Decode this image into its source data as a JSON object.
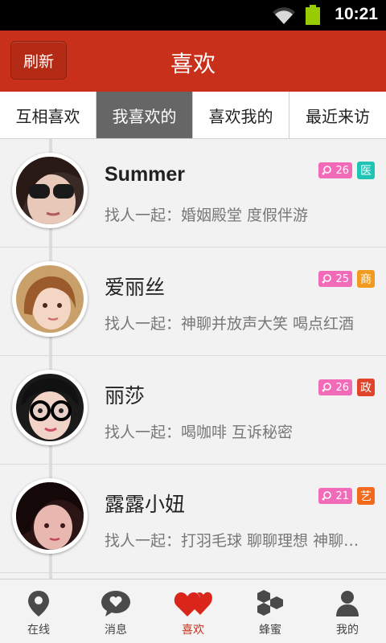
{
  "status_bar": {
    "time": "10:21",
    "wifi_icon": "wifi-icon",
    "battery_icon": "battery-icon",
    "battery_color": "#99cc00"
  },
  "header": {
    "refresh_label": "刷新",
    "title": "喜欢",
    "color": "#c9301b"
  },
  "tabs": [
    {
      "label": "互相喜欢",
      "active": false
    },
    {
      "label": "我喜欢的",
      "active": true
    },
    {
      "label": "喜欢我的",
      "active": false
    },
    {
      "label": "最近来访",
      "active": false
    }
  ],
  "users": [
    {
      "name": "Summer",
      "age": "26",
      "tag": "医",
      "tag_color": "#1fc4b4",
      "desc": "找人一起：婚姻殿堂 度假伴游"
    },
    {
      "name": "爱丽丝",
      "age": "25",
      "tag": "商",
      "tag_color": "#f29a1e",
      "desc": "找人一起：神聊并放声大笑 喝点红酒"
    },
    {
      "name": "丽莎",
      "age": "26",
      "tag": "政",
      "tag_color": "#e0452c",
      "desc": "找人一起：喝咖啡 互诉秘密"
    },
    {
      "name": "露露小妞",
      "age": "21",
      "tag": "艺",
      "tag_color": "#f26b1c",
      "desc": "找人一起：打羽毛球 聊聊理想 神聊并放声大笑"
    }
  ],
  "bottom_nav": [
    {
      "label": "在线",
      "icon": "location-pin-icon",
      "active": false
    },
    {
      "label": "消息",
      "icon": "chat-bubble-heart-icon",
      "active": false
    },
    {
      "label": "喜欢",
      "icon": "hearts-icon",
      "active": true
    },
    {
      "label": "蜂蜜",
      "icon": "honeycomb-icon",
      "active": false
    },
    {
      "label": "我的",
      "icon": "person-icon",
      "active": false
    }
  ]
}
